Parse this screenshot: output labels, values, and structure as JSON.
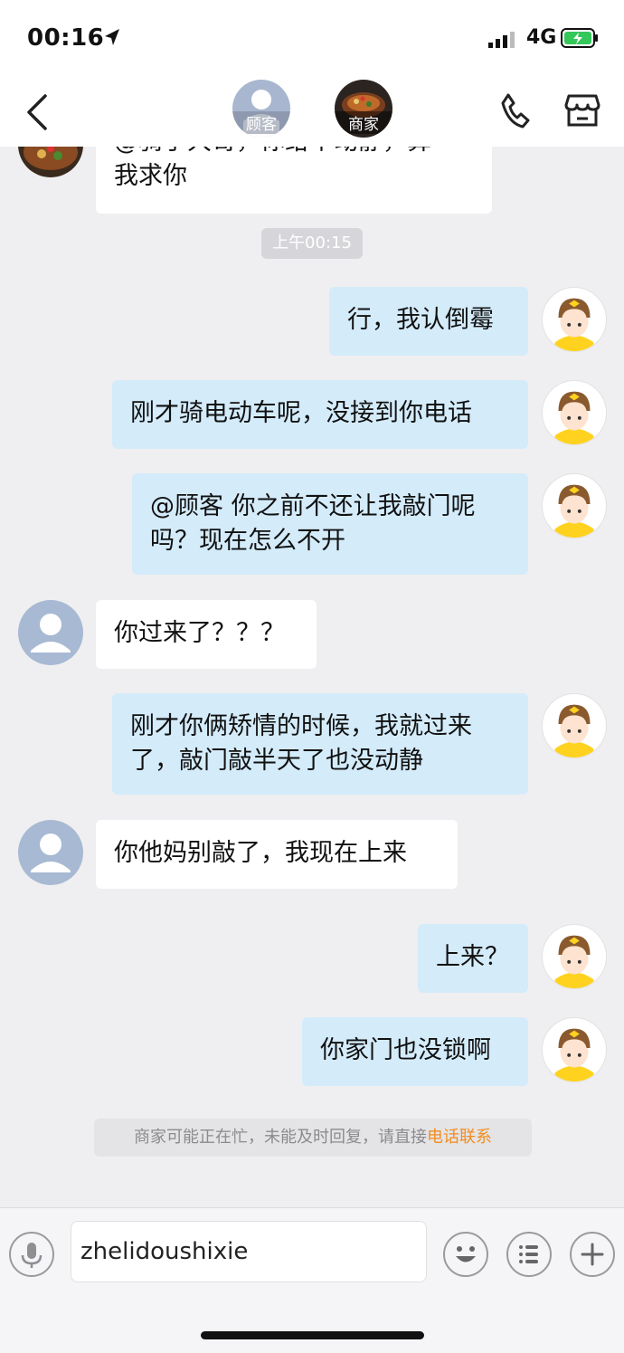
{
  "status": {
    "time": "00:16",
    "network": "4G"
  },
  "nav": {
    "customer_label": "顾客",
    "merchant_label": "商家"
  },
  "messages": [
    {
      "lines": [
        "@骑手大哥，你给个动静，算",
        "我求你"
      ]
    },
    {
      "lines": [
        "行，我认倒霉"
      ]
    },
    {
      "lines": [
        "刚才骑电动车呢，没接到你电话"
      ]
    },
    {
      "lines": [
        "@顾客 你之前不还让我敲门呢",
        "吗？现在怎么不开"
      ]
    },
    {
      "lines": [
        "你过来了？？？"
      ]
    },
    {
      "lines": [
        "刚才你俩矫情的时候，我就过来",
        "了，敲门敲半天了也没动静"
      ]
    },
    {
      "lines": [
        "你他妈别敲了，我现在上来"
      ]
    },
    {
      "lines": [
        "上来？"
      ]
    },
    {
      "lines": [
        "你家门也没锁啊"
      ]
    }
  ],
  "timestamp": "上午00:15",
  "notice": {
    "text": "商家可能正在忙，未能及时回复，请直接",
    "link": "电话联系"
  },
  "input": {
    "value": "zhelidoushixie"
  },
  "colors": {
    "bubble_out": "#d4ebfa",
    "bubble_in": "#ffffff",
    "link": "#f28c1e"
  }
}
